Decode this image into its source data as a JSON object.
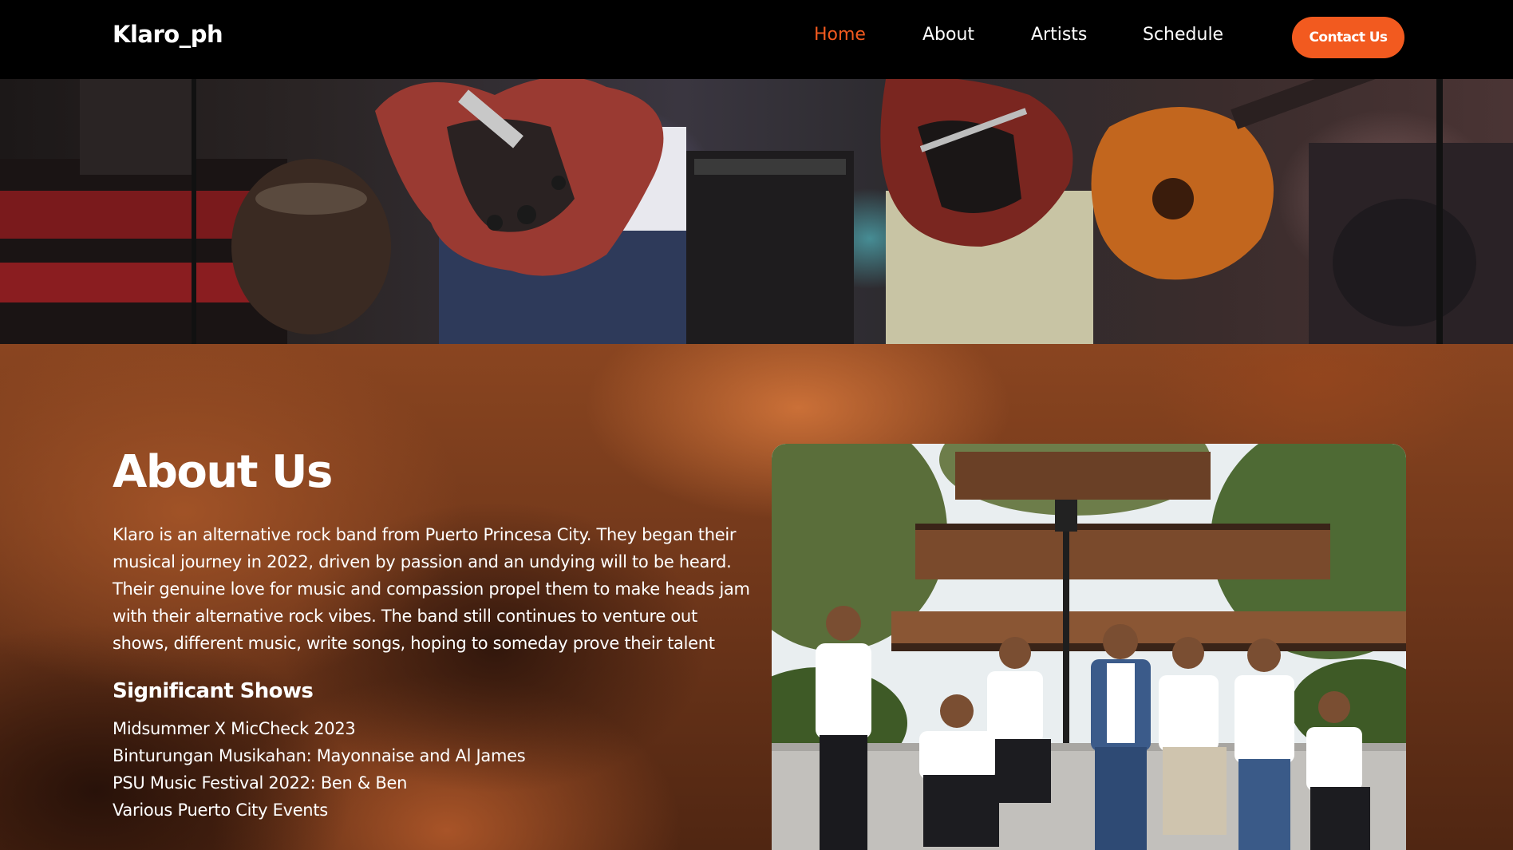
{
  "nav": {
    "brand": "Klaro_ph",
    "links": [
      {
        "label": "Home",
        "active": true
      },
      {
        "label": "About",
        "active": false
      },
      {
        "label": "Artists",
        "active": false
      },
      {
        "label": "Schedule",
        "active": false
      }
    ],
    "cta_label": "Contact Us"
  },
  "about": {
    "title": "About Us",
    "body": "Klaro is an alternative rock band from Puerto Princesa City. They began their musical journey in 2022, driven by passion and an undying will to be heard. Their genuine love for music and compassion propel them to make heads jam with their alternative rock vibes. The band still continues to venture out shows, different music, write songs, hoping to someday prove their talent",
    "shows_title": "Significant Shows",
    "shows": [
      "Midsummer X MicCheck 2023",
      "Binturungan Musikahan: Mayonnaise and Al James",
      "PSU Music Festival 2022: Ben & Ben",
      "Various Puerto City Events"
    ]
  },
  "colors": {
    "accent": "#f25a1f",
    "nav_bg": "#000000",
    "text": "#ffffff"
  }
}
